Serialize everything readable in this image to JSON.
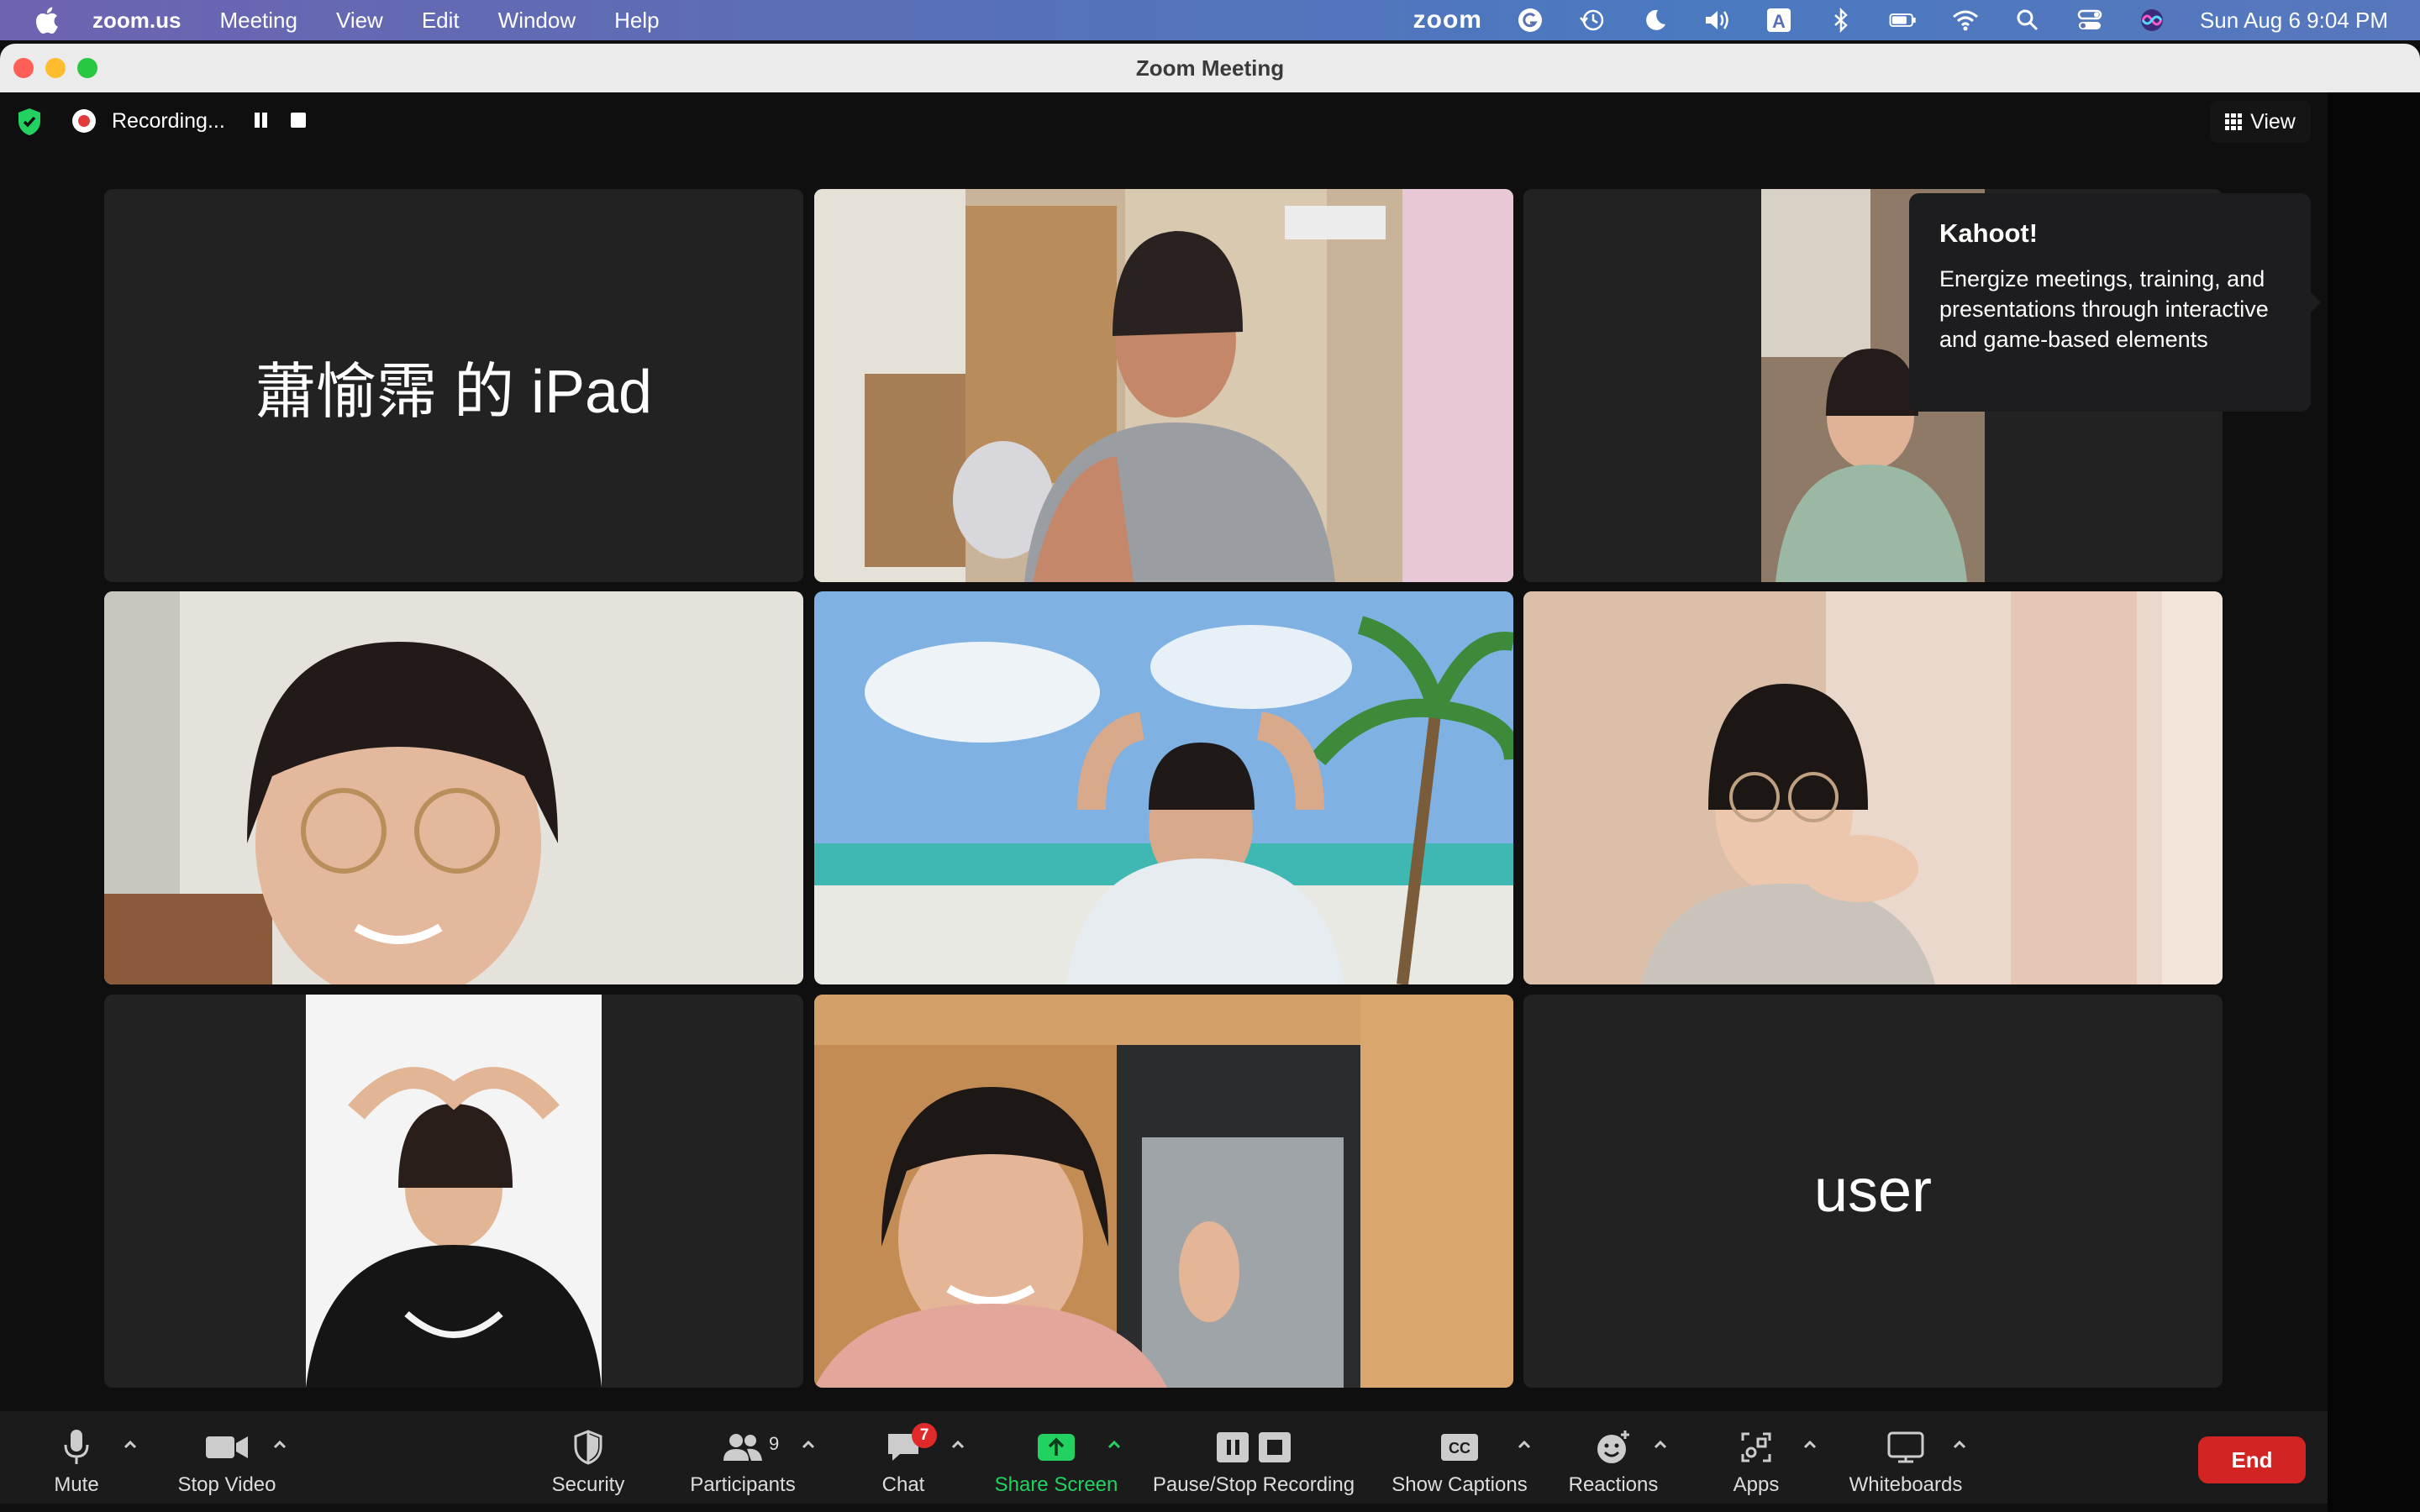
{
  "menubar": {
    "app_name": "zoom.us",
    "menus": [
      "Meeting",
      "View",
      "Edit",
      "Window",
      "Help"
    ],
    "zoom_logo": "zoom",
    "status_icons": [
      "grammarly-icon",
      "time-machine-icon",
      "moon-icon",
      "volume-icon",
      "input-source-icon",
      "bluetooth-icon",
      "battery-icon",
      "wifi-icon",
      "spotlight-icon",
      "control-center-icon",
      "siri-icon"
    ],
    "input_source": "A",
    "datetime": "Sun Aug 6  9:04 PM"
  },
  "window": {
    "title": "Zoom Meeting"
  },
  "topbar": {
    "recording_label": "Recording...",
    "view_label": "View"
  },
  "tiles": [
    {
      "name": "蕭愉霈 的 iPad",
      "type": "name"
    },
    {
      "type": "video",
      "active": true
    },
    {
      "type": "video"
    },
    {
      "type": "video"
    },
    {
      "type": "video"
    },
    {
      "type": "video"
    },
    {
      "type": "video"
    },
    {
      "type": "video"
    },
    {
      "name": "user",
      "type": "name"
    }
  ],
  "tooltip": {
    "title": "Kahoot!",
    "description": "Energize meetings, training, and presentations through interactive and game-based elements"
  },
  "toolbar": {
    "mute": "Mute",
    "stop_video": "Stop Video",
    "security": "Security",
    "participants": "Participants",
    "participants_count": "9",
    "chat": "Chat",
    "chat_badge": "7",
    "share_screen": "Share Screen",
    "pause_stop_recording": "Pause/Stop Recording",
    "show_captions": "Show Captions",
    "captions_icon_text": "CC",
    "reactions": "Reactions",
    "apps": "Apps",
    "whiteboards": "Whiteboards",
    "end": "End"
  },
  "colors": {
    "active_speaker": "#23d160",
    "share_green": "#23d160",
    "end_red": "#d32424",
    "badge_red": "#e02a2a"
  }
}
